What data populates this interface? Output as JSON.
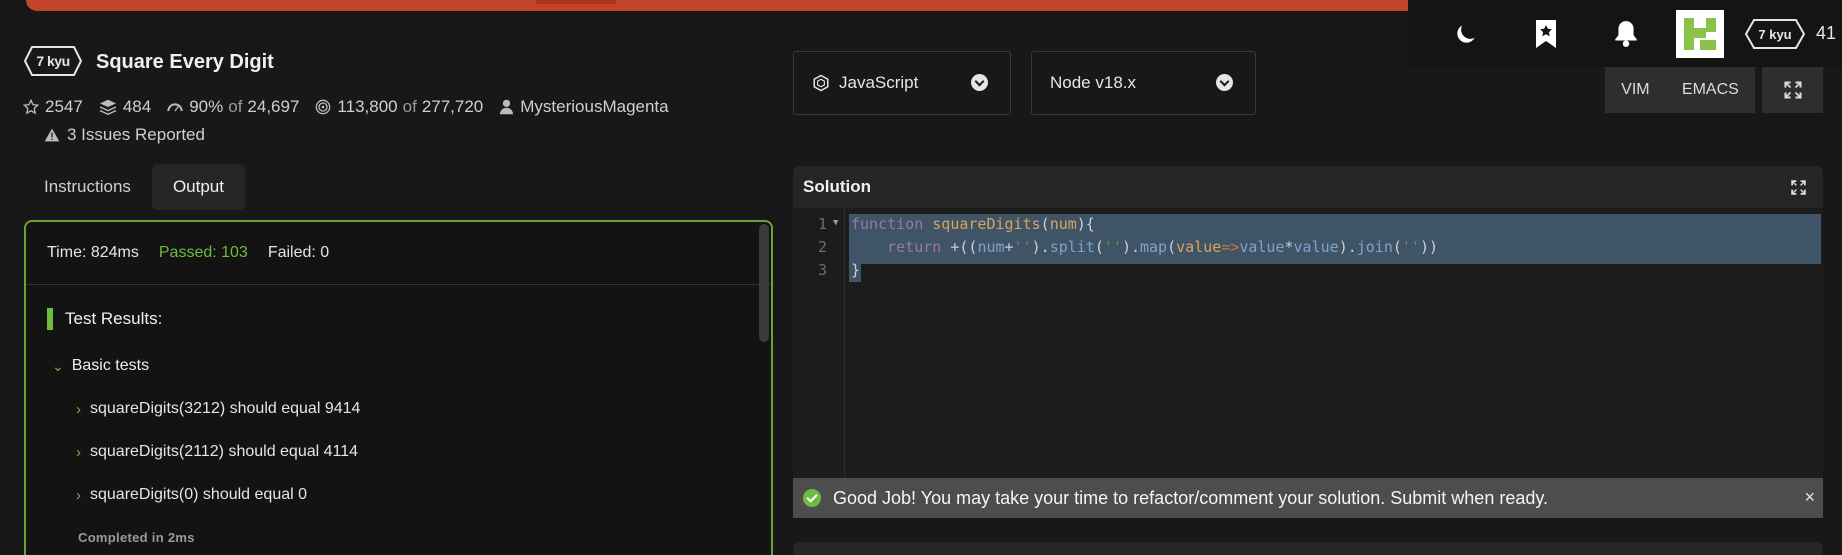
{
  "header": {
    "honor": "41",
    "rank": "7 kyu"
  },
  "kata": {
    "rank": "7 kyu",
    "title": "Square Every Digit",
    "stars": "2547",
    "collections": "484",
    "satisfaction_pct": "90%",
    "satisfaction_of": "of",
    "satisfaction_votes": "24,697",
    "completed": "113,800",
    "completed_of": "of",
    "attempts": "277,720",
    "author": "MysteriousMagenta",
    "issues": "3 Issues Reported"
  },
  "tabs": [
    {
      "label": "Instructions",
      "active": false
    },
    {
      "label": "Output",
      "active": true
    }
  ],
  "output": {
    "time": "Time: 824ms",
    "passed": "Passed: 103",
    "failed": "Failed: 0",
    "results_heading": "Test Results:",
    "group": "Basic tests",
    "tests": [
      "squareDigits(3212) should equal 9414",
      "squareDigits(2112) should equal 4114",
      "squareDigits(0) should equal 0"
    ],
    "completed": "Completed in 2ms"
  },
  "selectors": {
    "language": "JavaScript",
    "runtime": "Node v18.x"
  },
  "editor_modes": {
    "vim": "VIM",
    "emacs": "EMACS"
  },
  "solution": {
    "heading": "Solution",
    "line_numbers": [
      "1",
      "2",
      "3"
    ]
  },
  "toast": {
    "message": "Good Job! You may take your time to refactor/comment your solution. Submit when ready.",
    "close": "×"
  },
  "colors": {
    "accent_green": "#6cbd40",
    "topbar_red": "#c4442b",
    "selection": "#3f5466"
  }
}
